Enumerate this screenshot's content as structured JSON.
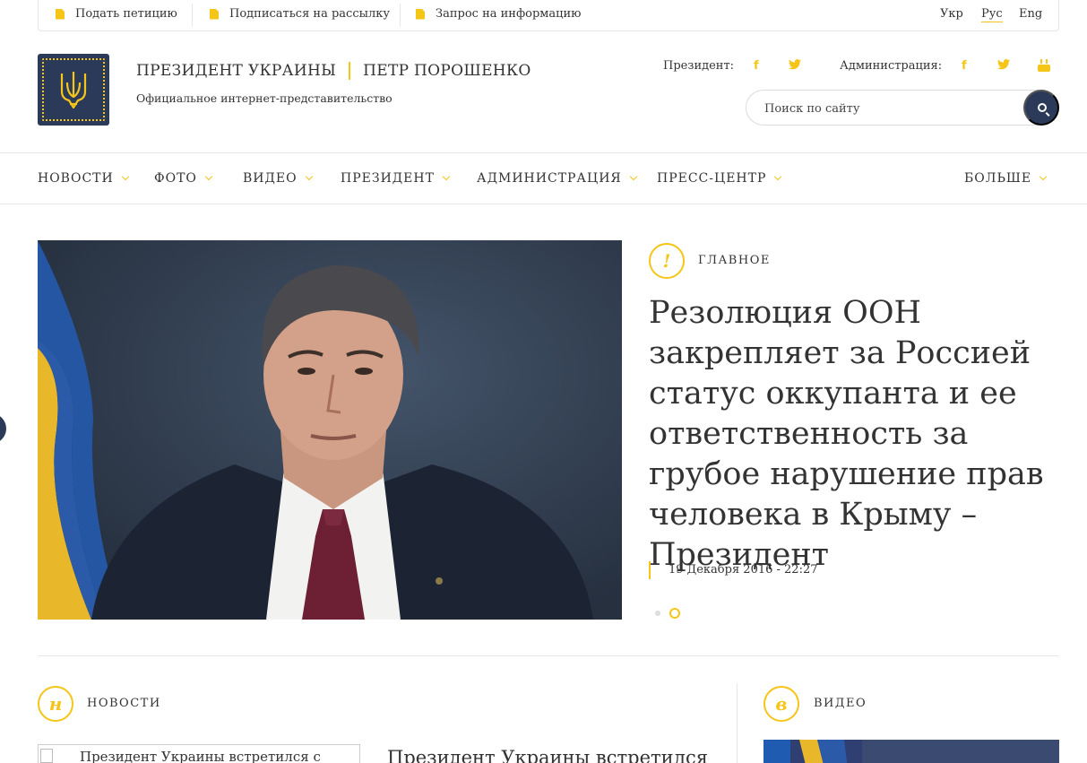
{
  "topbar": {
    "links": [
      {
        "label": "Подать петицию",
        "icon": "document-icon"
      },
      {
        "label": "Подписаться на рассылку",
        "icon": "document-icon"
      },
      {
        "label": "Запрос на информацию",
        "icon": "document-icon"
      }
    ],
    "languages": [
      {
        "label": "Укр",
        "active": false
      },
      {
        "label": "Рус",
        "active": true
      },
      {
        "label": "Eng",
        "active": false
      }
    ]
  },
  "header": {
    "title_left": "ПРЕЗИДЕНТ УКРАИНЫ",
    "title_right": "ПЕТР ПОРОШЕНКО",
    "subtitle": "Официальное интернет-представительство",
    "social": {
      "president_label": "Президент:",
      "administration_label": "Администрация:"
    },
    "search": {
      "placeholder": "Поиск по сайту"
    }
  },
  "nav": {
    "items": [
      "НОВОСТИ",
      "ФОТО",
      "ВИДЕО",
      "ПРЕЗИДЕНТ",
      "АДМИНИСТРАЦИЯ",
      "ПРЕСС-ЦЕНТР"
    ],
    "more": "БОЛЬШЕ"
  },
  "hero": {
    "badge": "!",
    "section": "ГЛАВНОЕ",
    "headline": "Резолюция ООН закрепляет за Россией статус оккупанта и ее ответственность за грубое нарушение прав человека в Крыму – Президент",
    "date": "19 Декабря 2016 - 22:27",
    "slides_total": 2,
    "slide_active": 2
  },
  "news": {
    "badge": "н",
    "section": "НОВОСТИ",
    "image_alt": "Президент Украины встретился с",
    "title": "Президент Украины встретился"
  },
  "video": {
    "badge": "в",
    "section": "ВИДЕО"
  },
  "colors": {
    "accent": "#f5c518",
    "navy": "#2c3a5a",
    "text": "#333333",
    "border": "#e6e6e6"
  }
}
